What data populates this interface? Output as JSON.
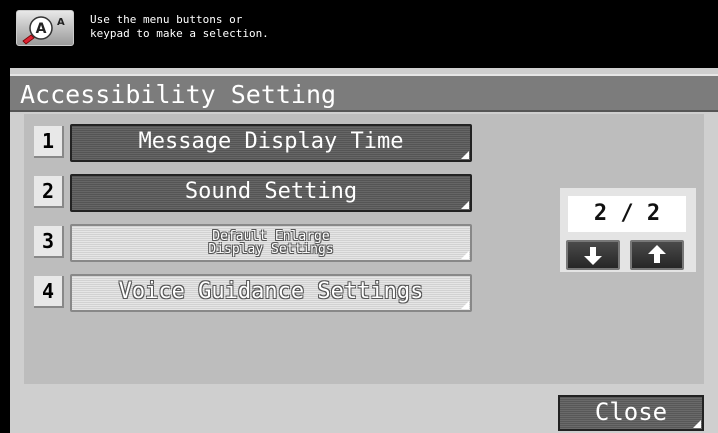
{
  "header": {
    "message_line1": "Use the menu buttons or",
    "message_line2": "keypad to make a selection.",
    "icon": "accessibility-icon"
  },
  "title": "Accessibility Setting",
  "menu": {
    "items": [
      {
        "number": "1",
        "label": "Message Display Time",
        "state": "active"
      },
      {
        "number": "2",
        "label": "Sound Setting",
        "state": "active"
      },
      {
        "number": "3",
        "label_line1": "Default Enlarge",
        "label_line2": "Display Settings",
        "state": "disabled"
      },
      {
        "number": "4",
        "label": "Voice Guidance Settings",
        "state": "disabled"
      }
    ]
  },
  "pager": {
    "page": "2 / 2",
    "down_icon": "arrow-down-icon",
    "up_icon": "arrow-up-icon"
  },
  "footer": {
    "close_label": "Close"
  },
  "colors": {
    "active_button": "#5e5e5e",
    "disabled_button": "#dcdcdc",
    "panel": "#cfcfcf",
    "title_bar": "#7c7c7c"
  }
}
